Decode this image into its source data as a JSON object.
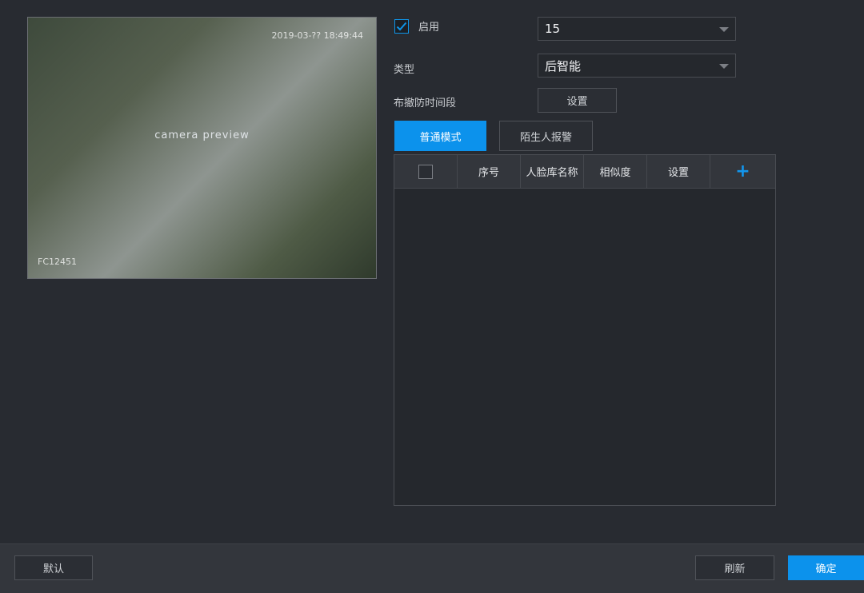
{
  "preview": {
    "placeholder": "camera preview",
    "timestamp_osd": "2019-03-?? 18:49:44",
    "channel_osd": "FC12451"
  },
  "enable": {
    "label": "启用",
    "checked": true
  },
  "channel": {
    "value": "15"
  },
  "type": {
    "label": "类型",
    "value": "后智能"
  },
  "schedule": {
    "label": "布撤防时间段",
    "button": "设置"
  },
  "modes": [
    {
      "label": "普通模式",
      "active": true
    },
    {
      "label": "陌生人报警",
      "active": false
    }
  ],
  "table": {
    "columns": [
      "序号",
      "人脸库名称",
      "相似度",
      "设置"
    ],
    "rows": []
  },
  "footer": {
    "default": "默认",
    "refresh": "刷新",
    "confirm": "确定"
  },
  "colors": {
    "accent": "#0c92ec",
    "background": "#282b31"
  }
}
